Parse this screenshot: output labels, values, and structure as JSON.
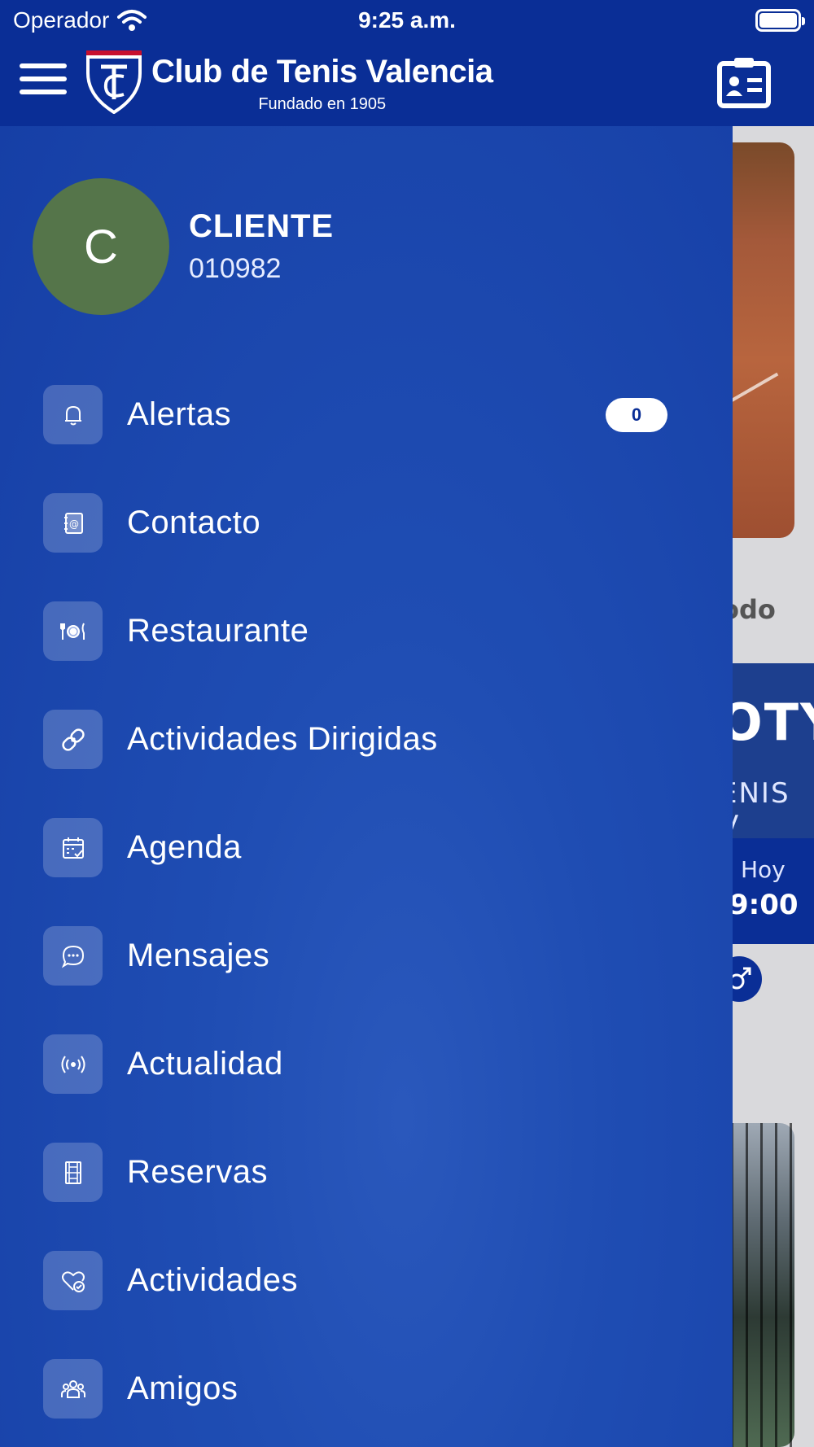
{
  "status_bar": {
    "carrier": "Operador",
    "time": "9:25 a.m."
  },
  "header": {
    "title": "Club de Tenis Valencia",
    "subtitle": "Fundado en 1905",
    "menu_icon": "hamburger-icon",
    "card_icon": "member-card-icon"
  },
  "profile": {
    "initial": "C",
    "name": "CLIENTE",
    "id": "010982",
    "avatar_color": "#55754a"
  },
  "menu": [
    {
      "label": "Alertas",
      "icon": "bell-icon",
      "badge": "0"
    },
    {
      "label": "Contacto",
      "icon": "contact-book-icon"
    },
    {
      "label": "Restaurante",
      "icon": "restaurant-icon"
    },
    {
      "label": "Actividades Dirigidas",
      "icon": "link-icon"
    },
    {
      "label": "Agenda",
      "icon": "calendar-check-icon"
    },
    {
      "label": "Mensajes",
      "icon": "chat-bubble-icon"
    },
    {
      "label": "Actualidad",
      "icon": "broadcast-icon"
    },
    {
      "label": "Reservas",
      "icon": "court-icon"
    },
    {
      "label": "Actividades",
      "icon": "heart-check-icon"
    },
    {
      "label": "Amigos",
      "icon": "group-icon"
    }
  ],
  "background": {
    "partial_text_1": "odo",
    "banner_title": "OTY",
    "banner_sub": "ENIS V",
    "day": "Hoy",
    "hour": "9:00"
  },
  "colors": {
    "header_blue": "#0a2e96",
    "drawer_blue": "#1f4db3",
    "badge_text": "#0a2e96"
  }
}
